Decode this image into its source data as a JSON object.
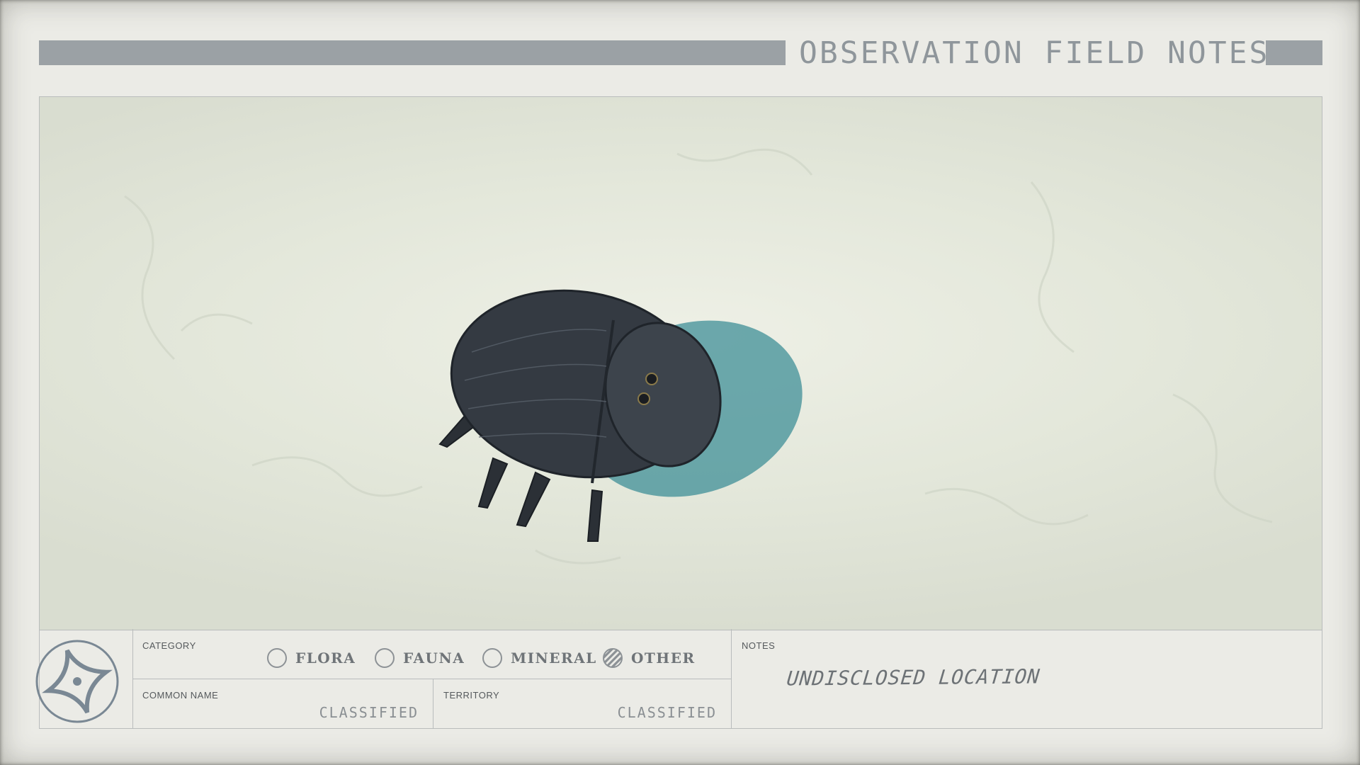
{
  "header": {
    "title": "OBSERVATION FIELD NOTES"
  },
  "photo": {
    "subject_icon": "beetle-creature",
    "ground_color": "#e3e7da",
    "shadow_color": "#3f8f97"
  },
  "logo": {
    "icon": "star-compass-emblem",
    "color": "#7a8894"
  },
  "category": {
    "label": "CATEGORY",
    "options": [
      {
        "label": "FLORA",
        "selected": false
      },
      {
        "label": "FAUNA",
        "selected": false
      },
      {
        "label": "MINERAL",
        "selected": false
      },
      {
        "label": "OTHER",
        "selected": true
      }
    ]
  },
  "common_name": {
    "label": "COMMON NAME",
    "value": "CLASSIFIED"
  },
  "territory": {
    "label": "TERRITORY",
    "value": "CLASSIFIED"
  },
  "notes": {
    "label": "NOTES",
    "value": "UNDISCLOSED LOCATION"
  }
}
